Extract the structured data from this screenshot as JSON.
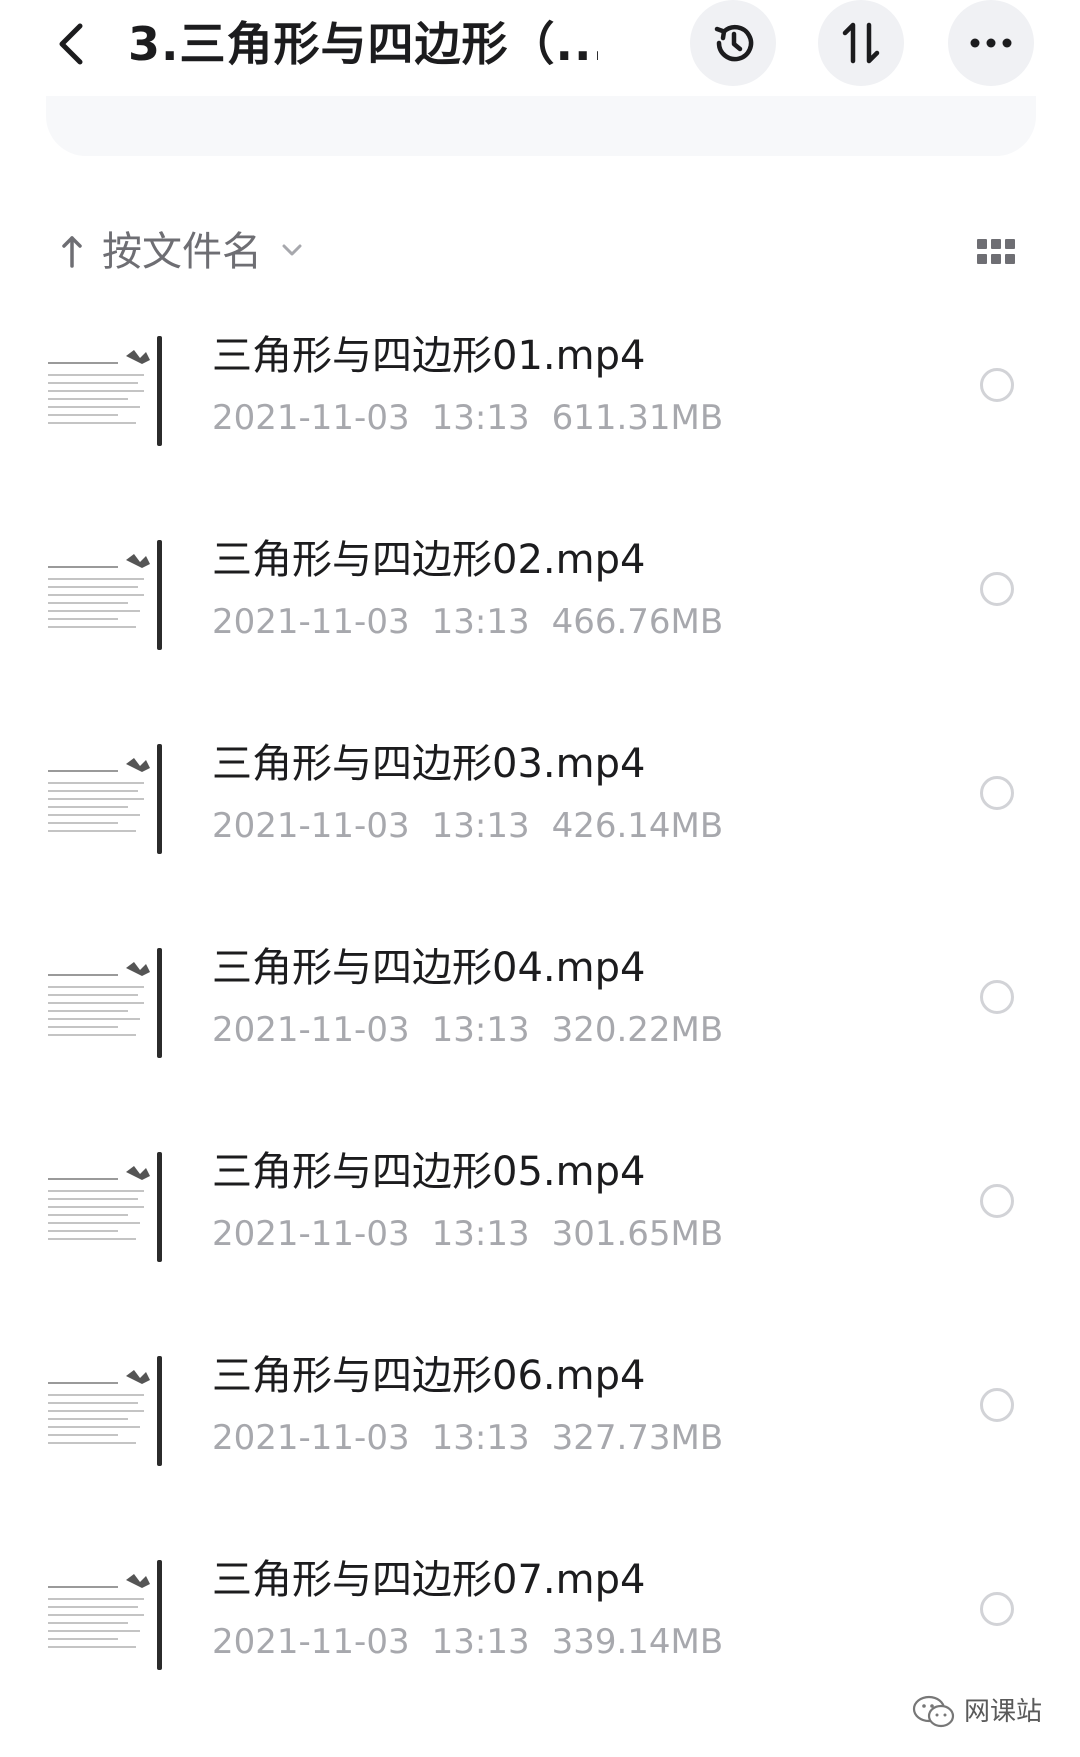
{
  "header": {
    "title": "3.三角形与四边形（...",
    "back_icon": "chevron-left-icon",
    "history_icon": "history-clock-icon",
    "sort_icon": "sort-updown-icon",
    "more_icon": "more-horizontal-icon"
  },
  "sort": {
    "label": "按文件名",
    "direction_icon": "arrow-up-icon",
    "dropdown_icon": "chevron-down-icon",
    "view_icon": "grid-view-icon"
  },
  "files": [
    {
      "name": "三角形与四边形01.mp4",
      "date": "2021-11-03",
      "time": "13:13",
      "size": "611.31MB"
    },
    {
      "name": "三角形与四边形02.mp4",
      "date": "2021-11-03",
      "time": "13:13",
      "size": "466.76MB"
    },
    {
      "name": "三角形与四边形03.mp4",
      "date": "2021-11-03",
      "time": "13:13",
      "size": "426.14MB"
    },
    {
      "name": "三角形与四边形04.mp4",
      "date": "2021-11-03",
      "time": "13:13",
      "size": "320.22MB"
    },
    {
      "name": "三角形与四边形05.mp4",
      "date": "2021-11-03",
      "time": "13:13",
      "size": "301.65MB"
    },
    {
      "name": "三角形与四边形06.mp4",
      "date": "2021-11-03",
      "time": "13:13",
      "size": "327.73MB"
    },
    {
      "name": "三角形与四边形07.mp4",
      "date": "2021-11-03",
      "time": "13:13",
      "size": "339.14MB"
    }
  ],
  "watermark": {
    "text": "网课站",
    "icon": "wechat-icon"
  },
  "colors": {
    "text_primary": "#1c1c1e",
    "text_secondary": "#a7a8ad",
    "button_bg": "#f0f1f4"
  }
}
